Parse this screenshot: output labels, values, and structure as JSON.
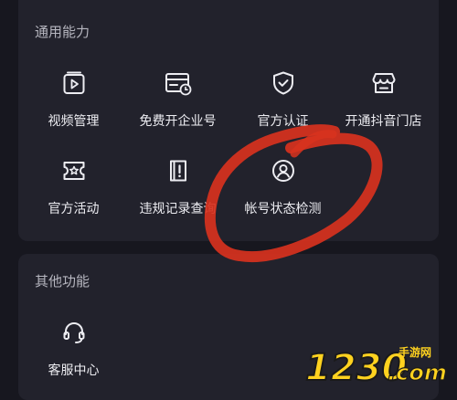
{
  "general": {
    "title": "通用能力",
    "items": [
      {
        "label": "视频管理",
        "icon": "video-folder-icon"
      },
      {
        "label": "免费开企业号",
        "icon": "enterprise-card-icon"
      },
      {
        "label": "官方认证",
        "icon": "shield-check-icon"
      },
      {
        "label": "开通抖音门店",
        "icon": "storefront-icon"
      },
      {
        "label": "官方活动",
        "icon": "ticket-star-icon"
      },
      {
        "label": "违规记录查询",
        "icon": "violation-record-icon"
      },
      {
        "label": "帐号状态检测",
        "icon": "account-status-icon"
      }
    ]
  },
  "other": {
    "title": "其他功能",
    "items": [
      {
        "label": "客服中心",
        "icon": "headset-icon"
      }
    ]
  },
  "annotation": {
    "color": "#d8321e"
  },
  "watermark": {
    "text": "1230",
    "suffix": ".com",
    "cn": "手游网"
  },
  "colors": {
    "background": "#17171f",
    "card": "#22222c",
    "text": "#ededf2",
    "section_title": "#b6b6bf"
  }
}
